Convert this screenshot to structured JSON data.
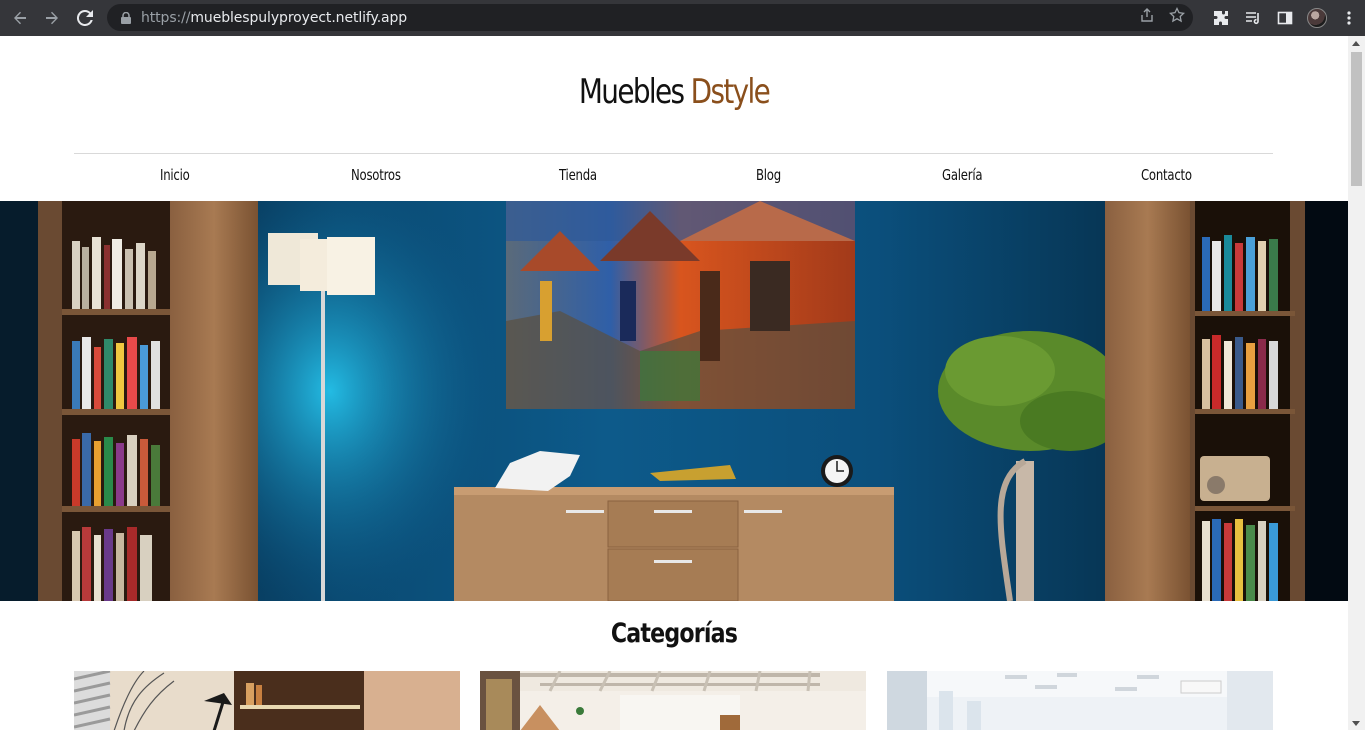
{
  "browser": {
    "url_scheme": "https://",
    "url_host": "mueblespulyproyect.netlify.app",
    "icons": [
      "back-icon",
      "forward-icon",
      "reload-icon",
      "lock-icon",
      "share-icon",
      "star-icon",
      "extensions-icon",
      "media-icon",
      "sidepanel-icon",
      "profile-avatar",
      "menu-icon"
    ]
  },
  "header": {
    "brand_main": "Muebles",
    "brand_accent": "Dstyle",
    "accent_color": "#8a4f1c"
  },
  "nav": {
    "items": [
      "Inicio",
      "Nosotros",
      "Tienda",
      "Blog",
      "Galería",
      "Contacto"
    ]
  },
  "hero": {
    "description_icon": "living-room-photo"
  },
  "categories": {
    "title": "Categorías",
    "cards": [
      "office-photo",
      "dining-room-photo",
      "white-office-photo"
    ]
  }
}
